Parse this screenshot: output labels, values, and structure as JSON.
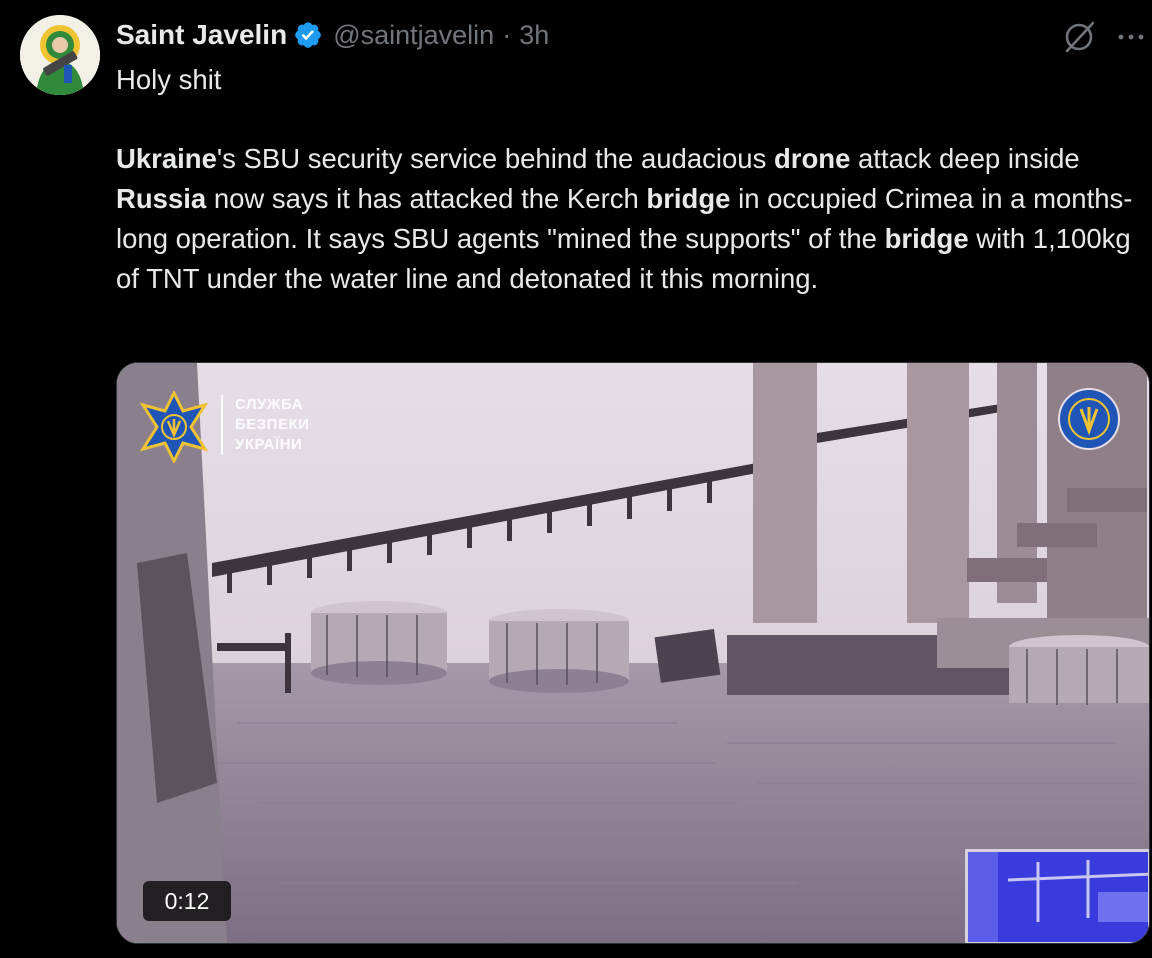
{
  "author": {
    "display_name": "Saint Javelin",
    "handle": "@saintjavelin",
    "separator": "·",
    "time": "3h",
    "verified": true
  },
  "icons": {
    "grok": "grok-icon",
    "more": "more-icon",
    "verified": "verified-badge-icon"
  },
  "tweet": {
    "line1": "Holy shit",
    "body_segments": [
      {
        "text": "Ukraine",
        "bold": true
      },
      {
        "text": "'s SBU security service behind the audacious ",
        "bold": false
      },
      {
        "text": "drone",
        "bold": true
      },
      {
        "text": " attack deep inside ",
        "bold": false
      },
      {
        "text": "Russia",
        "bold": true
      },
      {
        "text": " now says it has attacked the Kerch ",
        "bold": false
      },
      {
        "text": "bridge",
        "bold": true
      },
      {
        "text": " in occupied Crimea in a months-long operation. It says SBU agents \"mined the supports\" of the ",
        "bold": false
      },
      {
        "text": "bridge",
        "bold": true
      },
      {
        "text": " with 1,100kg of TNT under the water line and detonated it this morning.",
        "bold": false
      }
    ]
  },
  "media": {
    "overlay_text": [
      "СЛУЖБА",
      "БЕЗПЕКИ",
      "УКРАЇНИ"
    ],
    "duration": "0:12",
    "colors": {
      "sbu_blue": "#1f55b6",
      "sbu_gold": "#f1c232",
      "x_blue_badge": "#1d9bf0"
    }
  }
}
